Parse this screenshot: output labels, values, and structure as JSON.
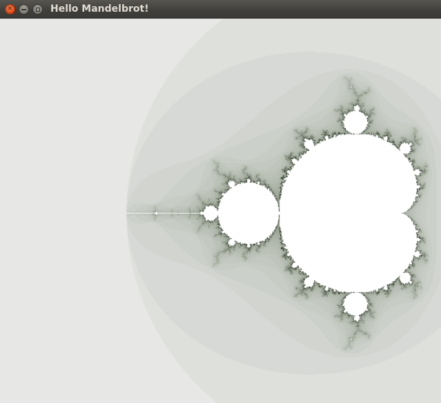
{
  "window": {
    "title": "Hello Mandelbrot!",
    "controls": {
      "close_icon": "close-icon",
      "minimize_icon": "minimize-icon",
      "maximize_icon": "maximize-icon"
    }
  },
  "fractal": {
    "name": "Mandelbrot set",
    "colors": {
      "background": "#ffffff",
      "set_interior": "#ffffff",
      "edge": "#1a1d14",
      "halo": "#e9efe2"
    }
  }
}
